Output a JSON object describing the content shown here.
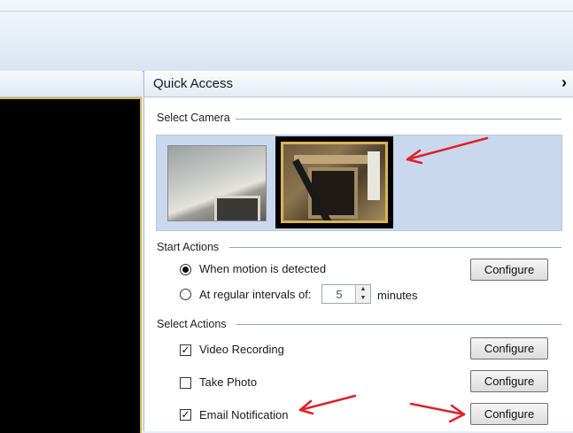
{
  "panel": {
    "title": "Quick Access",
    "expand_icon": "chevron-right-icon"
  },
  "select_camera": {
    "group_label": "Select Camera"
  },
  "start_actions": {
    "group_label": "Start Actions",
    "motion_label": "When motion is detected",
    "motion_selected": true,
    "interval_label": "At regular intervals of:",
    "interval_value": "5",
    "interval_unit": "minutes",
    "configure_label": "Configure"
  },
  "select_actions": {
    "group_label": "Select Actions",
    "items": [
      {
        "label": "Video Recording",
        "checked": true,
        "configure_label": "Configure"
      },
      {
        "label": "Take Photo",
        "checked": false,
        "configure_label": "Configure"
      },
      {
        "label": "Email Notification",
        "checked": true,
        "configure_label": "Configure"
      }
    ]
  },
  "colors": {
    "annotation_arrow": "#e0202a",
    "selected_frame": "#d9b454"
  }
}
